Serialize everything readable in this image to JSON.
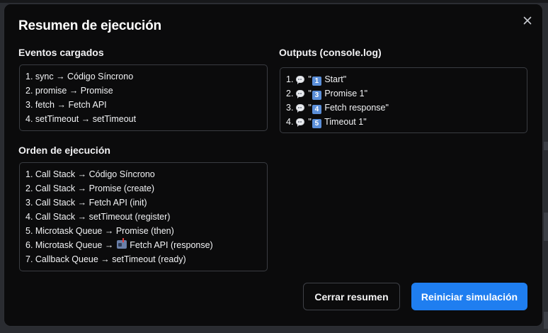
{
  "modal": {
    "title": "Resumen de ejecución",
    "close_icon": "close-icon"
  },
  "eventos": {
    "title": "Eventos cargados",
    "items": [
      "1. sync → Código Síncrono",
      "2. promise → Promise",
      "3. fetch → Fetch API",
      "4. setTimeout → setTimeout"
    ]
  },
  "orden": {
    "title": "Orden de ejecución",
    "items": [
      {
        "prefix": "1. Call Stack → Código Síncrono",
        "icon": "",
        "suffix": ""
      },
      {
        "prefix": "2. Call Stack → Promise (create)",
        "icon": "",
        "suffix": ""
      },
      {
        "prefix": "3. Call Stack → Fetch API (init)",
        "icon": "",
        "suffix": ""
      },
      {
        "prefix": "4. Call Stack → setTimeout (register)",
        "icon": "",
        "suffix": ""
      },
      {
        "prefix": "5. Microtask Queue → Promise (then)",
        "icon": "",
        "suffix": ""
      },
      {
        "prefix": "6. Microtask Queue → ",
        "icon": "mailbox-icon",
        "suffix": " Fetch API (response)"
      },
      {
        "prefix": "7. Callback Queue → setTimeout (ready)",
        "icon": "",
        "suffix": ""
      }
    ]
  },
  "outputs": {
    "title": "Outputs (console.log)",
    "icon": "speech-bubble-icon",
    "items": [
      {
        "num": "1.",
        "key": "1",
        "text": "Start\""
      },
      {
        "num": "2.",
        "key": "3",
        "text": "Promise 1\""
      },
      {
        "num": "3.",
        "key": "4",
        "text": "Fetch response\""
      },
      {
        "num": "4.",
        "key": "5",
        "text": "Timeout 1\""
      }
    ],
    "quote": "\""
  },
  "buttons": {
    "close_summary": "Cerrar resumen",
    "restart": "Reiniciar simulación"
  },
  "colors": {
    "background": "#0b0b0c",
    "primary": "#1f7ef0",
    "border": "#3a3c42"
  }
}
